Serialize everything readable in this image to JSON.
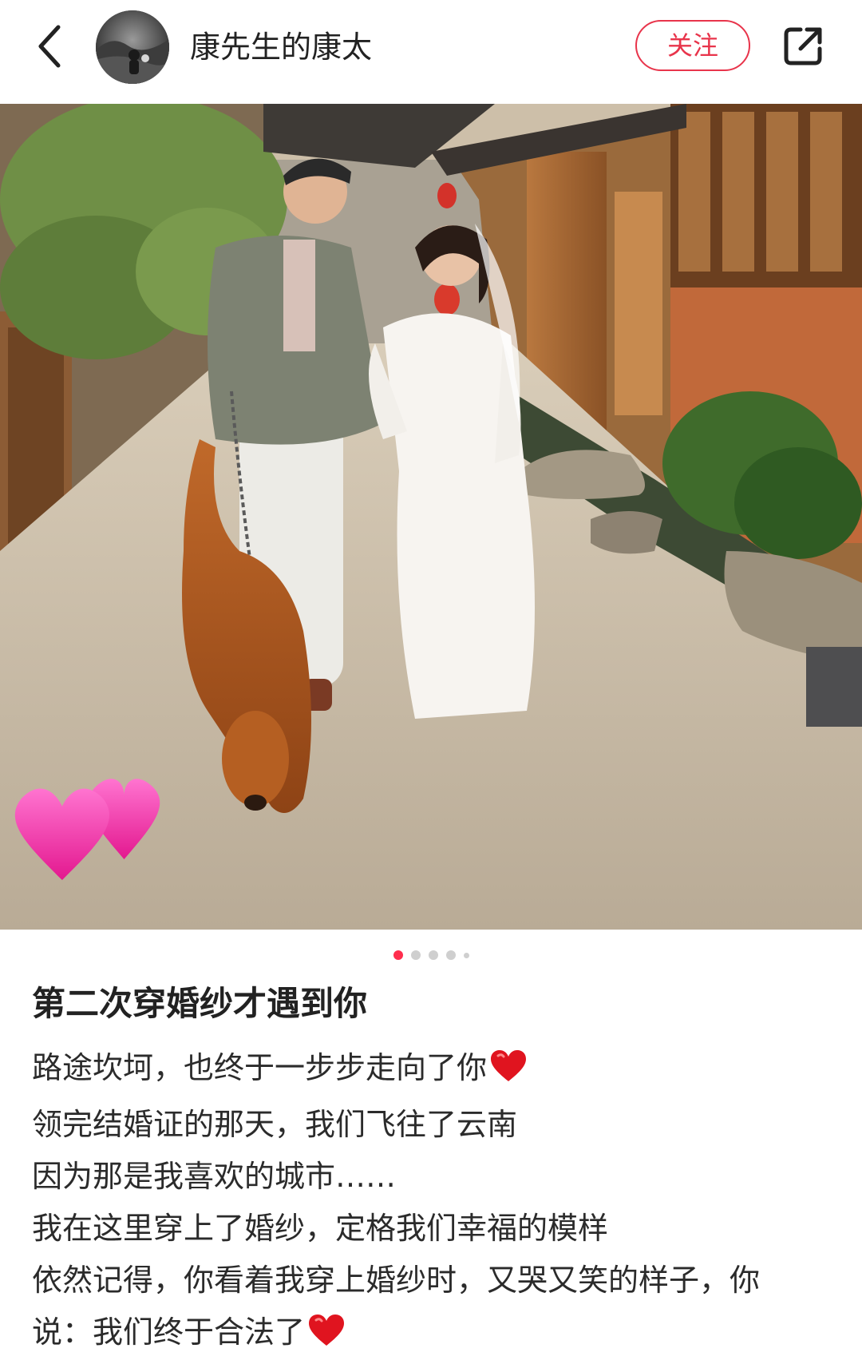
{
  "header": {
    "author_name": "康先生的康太",
    "follow_label": "关注",
    "icons": {
      "back": "chevron-left-icon",
      "share": "share-icon"
    }
  },
  "carousel": {
    "total_slides": 5,
    "active_index": 0,
    "accent_color": "#ff2e4d"
  },
  "post": {
    "title": "第二次穿婚纱才遇到你",
    "lines": [
      "路途坎坷，也终于一步步走向了你",
      "领完结婚证的那天，我们飞往了云南",
      "因为那是我喜欢的城市……",
      "我在这里穿上了婚纱，定格我们幸福的模样",
      "依然记得，你看着我穿上婚纱时，又哭又笑的样子，你",
      "说：我们终于合法了"
    ]
  },
  "colors": {
    "brand_red": "#e8344b",
    "text": "#222222"
  }
}
